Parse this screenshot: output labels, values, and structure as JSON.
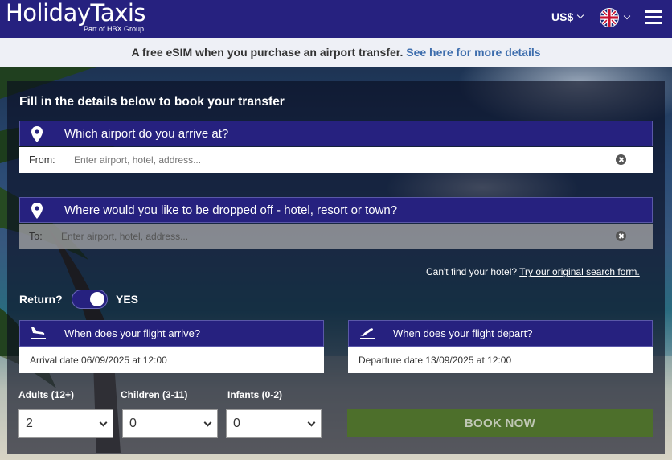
{
  "header": {
    "logo": "HolidayTaxis",
    "logo_sub": "Part of HBX Group",
    "currency": "US$",
    "colors": {
      "header_bg": "#26217f",
      "book_button": "#4d6f2b",
      "promo_link": "#3d6dad"
    }
  },
  "promo": {
    "text": "A free eSIM when you purchase an airport transfer.",
    "link": "See here for more details"
  },
  "form": {
    "title": "Fill in the details below to book your transfer",
    "arrive": {
      "question": "Which airport do you arrive at?",
      "label": "From:",
      "placeholder": "Enter airport, hotel, address..."
    },
    "dropoff": {
      "question": "Where would you like to be dropped off - hotel, resort or town?",
      "label": "To:",
      "placeholder": "Enter airport, hotel, address..."
    },
    "cant_find": "Can't find your hotel?",
    "cant_find_link": "Try our original search form.",
    "return_label": "Return?",
    "return_value": "YES",
    "arrival": {
      "question": "When does your flight arrive?",
      "value": "Arrival date 06/09/2025 at 12:00"
    },
    "departure": {
      "question": "When does your flight depart?",
      "value": "Departure date 13/09/2025 at 12:00"
    },
    "adults": {
      "label": "Adults (12+)",
      "value": "2"
    },
    "children": {
      "label": "Children (3-11)",
      "value": "0"
    },
    "infants": {
      "label": "Infants (0-2)",
      "value": "0"
    },
    "book_label": "BOOK NOW"
  },
  "icons": [
    "pin-icon",
    "plane-landing-icon",
    "plane-departure-icon",
    "clear-icon",
    "uk-flag-icon",
    "menu-icon",
    "chevron-down-icon"
  ]
}
